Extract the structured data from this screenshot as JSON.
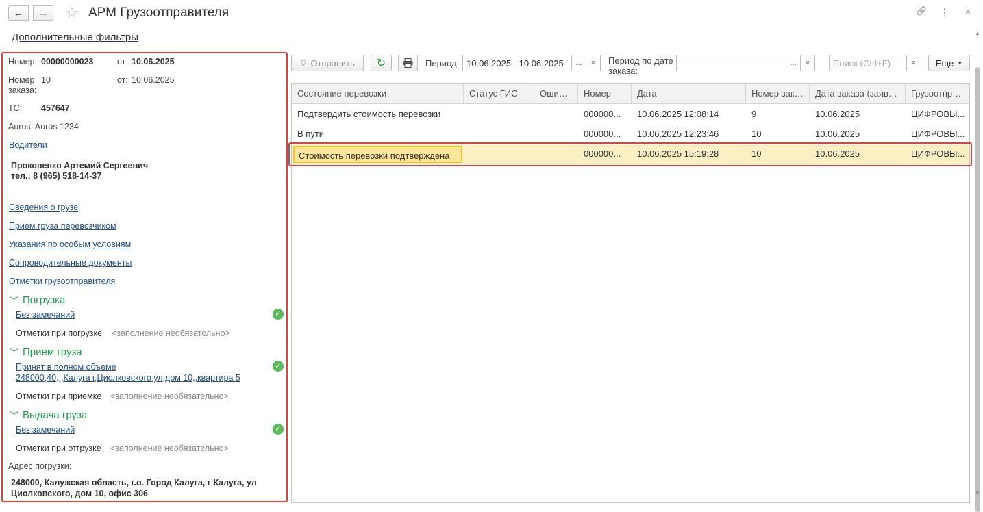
{
  "window": {
    "title": "АРМ Грузоотправителя",
    "back_icon": "←",
    "forward_icon": "→",
    "star_icon": "☆",
    "link_icon": "🔗",
    "menu_icon": "⋮",
    "close_icon": "×"
  },
  "additional_filters": "Дополнительные фильтры",
  "details": {
    "number_label": "Номер:",
    "number_value": "00000000023",
    "from_label": "от:",
    "number_date": "10.06.2025",
    "order_label_1": "Номер",
    "order_label_2": "заказа:",
    "order_value": "10",
    "order_from_label": "от:",
    "order_date": "10.06.2025",
    "ts_label": "ТС:",
    "ts_value": "457647",
    "vehicle": "Aurus, Aurus 1234",
    "drivers_link": "Водители",
    "driver_name": "Прокопенко Артемий Сергеевич",
    "driver_phone": "тел.: 8 (965) 518-14-37",
    "links": [
      "Сведения о грузе",
      "Прием груза перевозчиком",
      "Указания по особым условиям",
      "Сопроводительные документы",
      "Отметки грузоотправителя"
    ],
    "sections": [
      {
        "title": "Погрузка",
        "status_link": "Без замечаний",
        "status_link_2": "",
        "marks_label": "Отметки при погрузке",
        "marks_value": "<заполнение необязательно>"
      },
      {
        "title": "Прием груза",
        "status_link": "Принят в полном объеме",
        "status_link_2": "248000,40,,,Калуга г,Циолковского ул,дом 10,,квартира 5",
        "marks_label": "Отметки при приемке",
        "marks_value": "<заполнение необязательно>"
      },
      {
        "title": "Выдача груза",
        "status_link": "Без замечаний",
        "status_link_2": "",
        "marks_label": "Отметки при отгрузке",
        "marks_value": "<заполнение необязательно>"
      }
    ],
    "address_label": "Адрес погрузки:",
    "address_line1": "248000, Калужская область, г.о. Город Калуга, г Калуга, ул",
    "address_line2": "Циолковского, дом 10, офис 306"
  },
  "toolbar": {
    "send_label": "Отправить",
    "period_label": "Период:",
    "period_value": "10.06.2025 - 10.06.2025",
    "order_period_label_1": "Период по дате",
    "order_period_label_2": "заказа:",
    "order_period_value": "",
    "search_placeholder": "Поиск (Ctrl+F)",
    "more_label": "Еще",
    "dots": "...",
    "clear": "×"
  },
  "table": {
    "columns": [
      "Состояние перевозки",
      "Статус ГИС",
      "Ошибка",
      "Номер",
      "Дата",
      "Номер зака...",
      "Дата заказа (заявки)",
      "Грузоотправ..."
    ],
    "rows": [
      [
        "Подтвердить стоимость перевозки",
        "",
        "",
        "000000...",
        "10.06.2025 12:08:14",
        "9",
        "10.06.2025",
        "ЦИФРОВЫ..."
      ],
      [
        "В пути",
        "",
        "",
        "000000...",
        "10.06.2025 12:23:46",
        "10",
        "10.06.2025",
        "ЦИФРОВЫ..."
      ],
      [
        "Стоимость перевозки подтверждена",
        "",
        "",
        "000000...",
        "10.06.2025 15:19:28",
        "10",
        "10.06.2025",
        "ЦИФРОВЫ..."
      ]
    ],
    "selected_row": 2
  }
}
